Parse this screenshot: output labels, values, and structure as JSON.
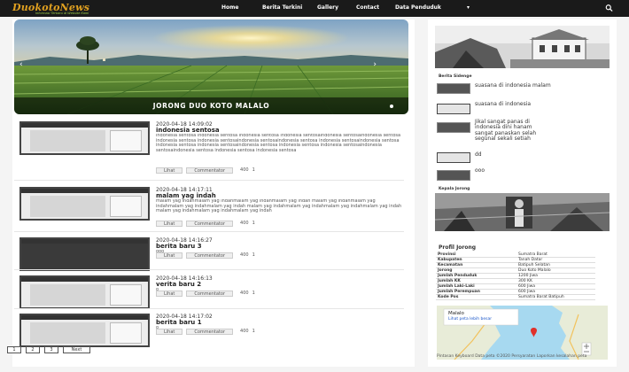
{
  "header": {
    "logo": "DuokotoNews",
    "tagline": "Informasi Terbaru di Website Kami",
    "nav": [
      "Home",
      "Berita Terkini",
      "Gallery",
      "Contact",
      "Data Penduduk"
    ],
    "dropdown_glyph": "▾"
  },
  "slider": {
    "caption": "JORONG DUO KOTO MALALO",
    "prev_arrow": "‹",
    "next_arrow": "›"
  },
  "posts": [
    {
      "date": "2020-04-18 14:09:02",
      "title": "indonesia sentosa",
      "excerpt": "indonesia sentosa indonesia sentosa indonesia sentosa indonesia sentosaindonesia sentosaindonesia sentosa indonesia sentosa indonesia sentosaindonesia sentosaindonesia sentosa indonesia sentosaindonesia sentosa indonesia sentosa indonesia sentosaindonesia sentosa indonesia sentosa indonesia sentosaindonesia sentosaindonesia sentosa indonesia sentosa indonesia sentosa",
      "btn_more": "Lihat",
      "btn_comment": "Commentator",
      "views": "400",
      "comments": "1"
    },
    {
      "date": "2020-04-18 14:17:11",
      "title": "malam yag indah",
      "excerpt": "malam yag indahmalam yag indahmalam yag indahmalam yag indah malam yag indahmalam yag indahmalam yag indahmalam yag indah malam yag indahmalam yag indahmalam yag indahmalam yag indah malam yag indahmalam yag indahmalam yag indah",
      "btn_more": "Lihat",
      "btn_comment": "Commentator",
      "views": "400",
      "comments": "1"
    },
    {
      "date": "2020-04-18 14:16:27",
      "title": "berita baru 3",
      "excerpt": "ooo",
      "btn_more": "Lihat",
      "btn_comment": "Commentator",
      "views": "400",
      "comments": "1"
    },
    {
      "date": "2020-04-18 14:16:13",
      "title": "verita baru 2",
      "excerpt": "o",
      "btn_more": "Lihat",
      "btn_comment": "Commentator",
      "views": "400",
      "comments": "1"
    },
    {
      "date": "2020-04-18 14:17:02",
      "title": "berita baru 1",
      "excerpt": "o",
      "btn_more": "Lihat",
      "btn_comment": "Commentator",
      "views": "400",
      "comments": "1"
    }
  ],
  "pagination": [
    "1",
    "2",
    "3",
    "Next"
  ],
  "sidebar": {
    "recent_heading": "Berita Sidenge",
    "recent": [
      {
        "title": "suasana di indonesia malam",
        "thumb": "dark"
      },
      {
        "title": "suasana di indonesia",
        "thumb": "light"
      },
      {
        "title": "Jikal sangat panas di indonesia dini hanam sangat panaskan selah segunal sekali setiah",
        "thumb": "dark"
      },
      {
        "title": "dd",
        "thumb": "light"
      },
      {
        "title": "ooo",
        "thumb": "dark"
      }
    ],
    "head_heading": "Kepala Jorong",
    "profile_heading": "Profil Jorong",
    "profile": [
      {
        "k": "Provinsi",
        "v": "Sumatra Barat"
      },
      {
        "k": "Kabupaten",
        "v": "Tanah Datar"
      },
      {
        "k": "Kecamatan",
        "v": "Batipuh Selatan"
      },
      {
        "k": "Jorong",
        "v": "Duo Koto Malalo"
      },
      {
        "k": "Jumlah Penduduk",
        "v": "1200 Jiwa"
      },
      {
        "k": "Jumlah KK",
        "v": "300 KK"
      },
      {
        "k": "Jumlah Laki-Laki",
        "v": "600 Jiwa"
      },
      {
        "k": "Jumlah Perempuan",
        "v": "600 Jiwa"
      },
      {
        "k": "Kode Pos",
        "v": "Sumatra Barat Batipuh"
      }
    ],
    "map": {
      "place": "Malalo",
      "link": "Lihat peta lebih besar",
      "footer": "Pintasan  Keyboard   Data peta ©2020   Persyaratan   Laporkan kesalahan peta"
    }
  },
  "colors": {
    "logo": "#e0a020",
    "tagline": "#9bd04a",
    "topbar": "#1a1a1a"
  }
}
